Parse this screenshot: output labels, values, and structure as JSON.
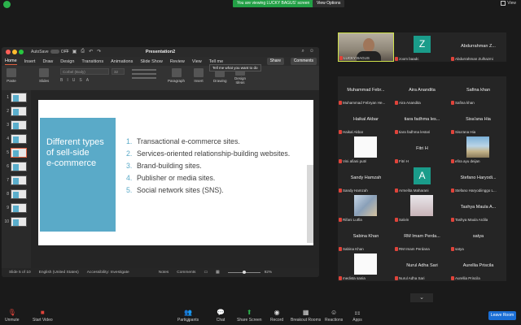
{
  "topbar": {
    "viewing_notice": "You are viewing LUCKY BAGUS' screen",
    "view_options": "View Options",
    "view_label": "View"
  },
  "ppt": {
    "autosave_label": "AutoSave",
    "autosave_state": "OFF",
    "doc_title": "Presentation2",
    "tabs": [
      "Home",
      "Insert",
      "Draw",
      "Design",
      "Transitions",
      "Animations",
      "Slide Show",
      "Review",
      "View",
      "Tell me"
    ],
    "tellme_tip": "Tell me what you want to do",
    "share_label": "Share",
    "comments_label": "Comments",
    "ribbon": {
      "paste": "Paste",
      "slides": "Slides",
      "font_name": "Corbel (Body)",
      "font_size": "32",
      "paragraph": "Paragraph",
      "insert": "Insert",
      "drawing": "Drawing",
      "design_ideas_line1": "Design",
      "design_ideas_line2": "Ideas"
    },
    "thumbnail_numbers": [
      "1",
      "2",
      "3",
      "4",
      "5",
      "6",
      "7",
      "8",
      "9",
      "10"
    ],
    "slide": {
      "heading_lines": [
        "Different types",
        "of sell-side",
        "e-commerce"
      ],
      "list": [
        {
          "num": "1.",
          "text": "Transactional e-commerce sites."
        },
        {
          "num": "2.",
          "text": "Services-oriented relationship-building websites."
        },
        {
          "num": "3.",
          "text": "Brand-building sites."
        },
        {
          "num": "4.",
          "text": "Publisher or media sites."
        },
        {
          "num": "5.",
          "text": "Social network sites (SNS)."
        }
      ]
    },
    "status": {
      "slide_of": "Slide 5 of 10",
      "language": "English (United States)",
      "accessibility": "Accessibility: Investigate",
      "notes": "Notes",
      "comments": "Comments",
      "zoom": "92%"
    }
  },
  "participants": [
    {
      "name": "",
      "label": "LUCKY BAGUS",
      "kind": "video"
    },
    {
      "name": "",
      "label": "zoom baadc",
      "kind": "letter",
      "letter": "Z",
      "color": "#1a9c8a"
    },
    {
      "name": "Abdurrahman Z...",
      "label": "Abdurrahman Zulhazmi",
      "kind": "name"
    },
    {
      "name": "Muhammad Febr...",
      "label": "Muhammad Febryan He...",
      "kind": "name"
    },
    {
      "name": "Aira Anandita",
      "label": "Aira Anandita",
      "kind": "name"
    },
    {
      "name": "Safina khan",
      "label": "Safina khan",
      "kind": "name"
    },
    {
      "name": "Haikal Akbar",
      "label": "Haikal Akbar",
      "kind": "name"
    },
    {
      "name": "tiara fadhma les...",
      "label": "tiara fadhma lestari",
      "kind": "name"
    },
    {
      "name": "Sisa'ana Hia",
      "label": "Sisa'ana Hia",
      "kind": "name"
    },
    {
      "name": "",
      "label": "Vini afiani putri",
      "kind": "pic",
      "pic": "white"
    },
    {
      "name": "Fitri H",
      "label": "Fitri H",
      "kind": "name"
    },
    {
      "name": "",
      "label": "efira ayu deijan",
      "kind": "pic",
      "pic": "beach"
    },
    {
      "name": "Sandy Hamzah",
      "label": "Sandy Hamzah",
      "kind": "name"
    },
    {
      "name": "",
      "label": "Armelita Maharani",
      "kind": "letter",
      "letter": "A",
      "color": "#1a9c8a"
    },
    {
      "name": "Stefano Haryodi...",
      "label": "Stefano Haryodiinggo L...",
      "kind": "name"
    },
    {
      "name": "",
      "label": "Rifani Lutfia",
      "kind": "pic",
      "pic": "room"
    },
    {
      "name": "",
      "label": "Salvin",
      "kind": "pic",
      "pic": "girl"
    },
    {
      "name": "Tashya Maula A...",
      "label": "Tashya Maula Ardila",
      "kind": "name"
    },
    {
      "name": "Sabina Khan",
      "label": "Sabina Khan",
      "kind": "name"
    },
    {
      "name": "RM Imam Perda...",
      "label": "RM Imam Perdana",
      "kind": "name"
    },
    {
      "name": "satya",
      "label": "satya",
      "kind": "name"
    },
    {
      "name": "",
      "label": "medista sania",
      "kind": "pic",
      "pic": "white"
    },
    {
      "name": "Nurul Adha Sari",
      "label": "Nurul Adha Sari",
      "kind": "name"
    },
    {
      "name": "Aurellia Priscila",
      "label": "Aurellia Priscila",
      "kind": "name"
    }
  ],
  "toolbar": {
    "unmute": "Unmute",
    "start_video": "Start Video",
    "participants": "Participants",
    "participant_count": "41",
    "chat": "Chat",
    "share_screen": "Share Screen",
    "record": "Record",
    "breakout": "Breakout Rooms",
    "reactions": "Reactions",
    "apps": "Apps",
    "leave": "Leave Room"
  },
  "colors": {
    "accent_green": "#2bb24c",
    "slide_blue": "#5aaac8",
    "leave_blue": "#1b6fd6",
    "muted_red": "#e0433a"
  }
}
